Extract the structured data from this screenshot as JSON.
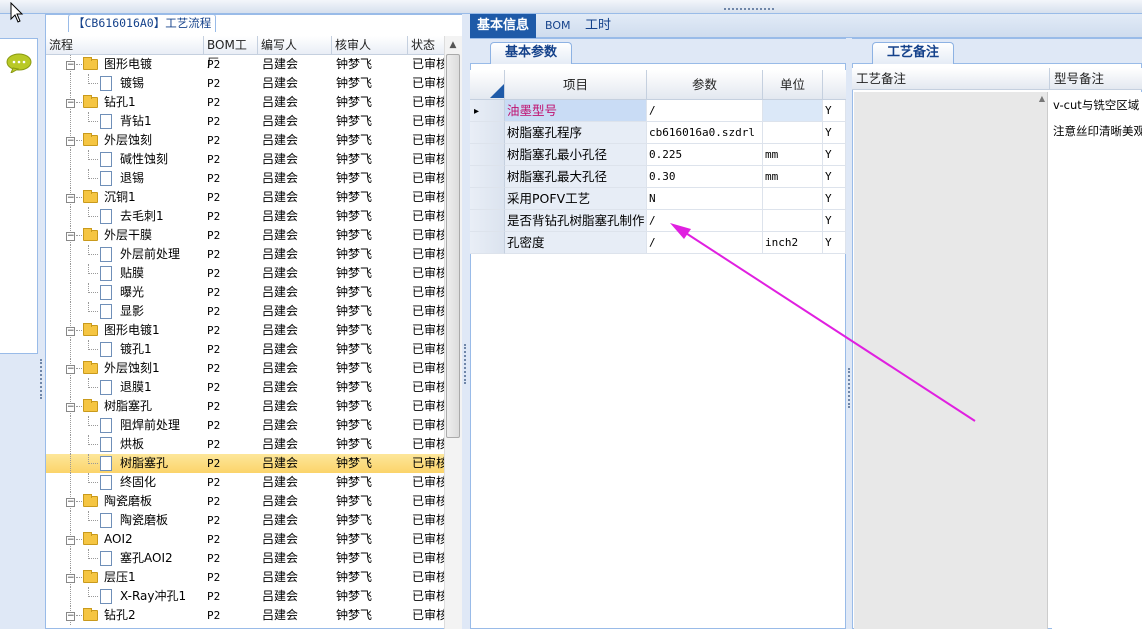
{
  "tree": {
    "title": "【CB616016A0】工艺流程",
    "columns": [
      "流程",
      "BOM工厂",
      "编写人",
      "核审人",
      "状态"
    ],
    "rows": [
      {
        "level": 1,
        "type": "folder",
        "name": "图形电镀",
        "bom": "P2",
        "author": "吕建会",
        "reviewer": "钟梦飞",
        "status": "已审核"
      },
      {
        "level": 2,
        "type": "doc",
        "name": "镀锡",
        "bom": "P2",
        "author": "吕建会",
        "reviewer": "钟梦飞",
        "status": "已审核"
      },
      {
        "level": 1,
        "type": "folder",
        "name": "钻孔1",
        "bom": "P2",
        "author": "吕建会",
        "reviewer": "钟梦飞",
        "status": "已审核"
      },
      {
        "level": 2,
        "type": "doc",
        "name": "背钻1",
        "bom": "P2",
        "author": "吕建会",
        "reviewer": "钟梦飞",
        "status": "已审核"
      },
      {
        "level": 1,
        "type": "folder",
        "name": "外层蚀刻",
        "bom": "P2",
        "author": "吕建会",
        "reviewer": "钟梦飞",
        "status": "已审核"
      },
      {
        "level": 2,
        "type": "doc",
        "name": "碱性蚀刻",
        "bom": "P2",
        "author": "吕建会",
        "reviewer": "钟梦飞",
        "status": "已审核"
      },
      {
        "level": 2,
        "type": "doc",
        "name": "退锡",
        "bom": "P2",
        "author": "吕建会",
        "reviewer": "钟梦飞",
        "status": "已审核"
      },
      {
        "level": 1,
        "type": "folder",
        "name": "沉铜1",
        "bom": "P2",
        "author": "吕建会",
        "reviewer": "钟梦飞",
        "status": "已审核"
      },
      {
        "level": 2,
        "type": "doc",
        "name": "去毛刺1",
        "bom": "P2",
        "author": "吕建会",
        "reviewer": "钟梦飞",
        "status": "已审核"
      },
      {
        "level": 1,
        "type": "folder",
        "name": "外层干膜",
        "bom": "P2",
        "author": "吕建会",
        "reviewer": "钟梦飞",
        "status": "已审核"
      },
      {
        "level": 2,
        "type": "doc",
        "name": "外层前处理",
        "bom": "P2",
        "author": "吕建会",
        "reviewer": "钟梦飞",
        "status": "已审核"
      },
      {
        "level": 2,
        "type": "doc",
        "name": "贴膜",
        "bom": "P2",
        "author": "吕建会",
        "reviewer": "钟梦飞",
        "status": "已审核"
      },
      {
        "level": 2,
        "type": "doc",
        "name": "曝光",
        "bom": "P2",
        "author": "吕建会",
        "reviewer": "钟梦飞",
        "status": "已审核"
      },
      {
        "level": 2,
        "type": "doc",
        "name": "显影",
        "bom": "P2",
        "author": "吕建会",
        "reviewer": "钟梦飞",
        "status": "已审核"
      },
      {
        "level": 1,
        "type": "folder",
        "name": "图形电镀1",
        "bom": "P2",
        "author": "吕建会",
        "reviewer": "钟梦飞",
        "status": "已审核"
      },
      {
        "level": 2,
        "type": "doc",
        "name": "镀孔1",
        "bom": "P2",
        "author": "吕建会",
        "reviewer": "钟梦飞",
        "status": "已审核"
      },
      {
        "level": 1,
        "type": "folder",
        "name": "外层蚀刻1",
        "bom": "P2",
        "author": "吕建会",
        "reviewer": "钟梦飞",
        "status": "已审核"
      },
      {
        "level": 2,
        "type": "doc",
        "name": "退膜1",
        "bom": "P2",
        "author": "吕建会",
        "reviewer": "钟梦飞",
        "status": "已审核"
      },
      {
        "level": 1,
        "type": "folder",
        "name": "树脂塞孔",
        "bom": "P2",
        "author": "吕建会",
        "reviewer": "钟梦飞",
        "status": "已审核"
      },
      {
        "level": 2,
        "type": "doc",
        "name": "阻焊前处理",
        "bom": "P2",
        "author": "吕建会",
        "reviewer": "钟梦飞",
        "status": "已审核"
      },
      {
        "level": 2,
        "type": "doc",
        "name": "烘板",
        "bom": "P2",
        "author": "吕建会",
        "reviewer": "钟梦飞",
        "status": "已审核"
      },
      {
        "level": 2,
        "type": "doc",
        "name": "树脂塞孔",
        "bom": "P2",
        "author": "吕建会",
        "reviewer": "钟梦飞",
        "status": "已审核",
        "selected": true
      },
      {
        "level": 2,
        "type": "doc",
        "name": "终固化",
        "bom": "P2",
        "author": "吕建会",
        "reviewer": "钟梦飞",
        "status": "已审核"
      },
      {
        "level": 1,
        "type": "folder",
        "name": "陶瓷磨板",
        "bom": "P2",
        "author": "吕建会",
        "reviewer": "钟梦飞",
        "status": "已审核"
      },
      {
        "level": 2,
        "type": "doc",
        "name": "陶瓷磨板",
        "bom": "P2",
        "author": "吕建会",
        "reviewer": "钟梦飞",
        "status": "已审核"
      },
      {
        "level": 1,
        "type": "folder",
        "name": "AOI2",
        "bom": "P2",
        "author": "吕建会",
        "reviewer": "钟梦飞",
        "status": "已审核"
      },
      {
        "level": 2,
        "type": "doc",
        "name": "塞孔AOI2",
        "bom": "P2",
        "author": "吕建会",
        "reviewer": "钟梦飞",
        "status": "已审核"
      },
      {
        "level": 1,
        "type": "folder",
        "name": "层压1",
        "bom": "P2",
        "author": "吕建会",
        "reviewer": "钟梦飞",
        "status": "已审核"
      },
      {
        "level": 2,
        "type": "doc",
        "name": "X-Ray冲孔1",
        "bom": "P2",
        "author": "吕建会",
        "reviewer": "钟梦飞",
        "status": "已审核"
      },
      {
        "level": 1,
        "type": "folder",
        "name": "钻孔2",
        "bom": "P2",
        "author": "吕建会",
        "reviewer": "钟梦飞",
        "status": "已审核"
      }
    ]
  },
  "middle": {
    "tabs": [
      "基本信息",
      "BOM",
      "工时"
    ],
    "subtab": "基本参数",
    "columns": [
      "项目",
      "参数",
      "单位"
    ],
    "rows": [
      {
        "item": "油墨型号",
        "value": "/",
        "unit": "",
        "flag": "Y",
        "current": true
      },
      {
        "item": "树脂塞孔程序",
        "value": "cb616016a0.szdrl",
        "unit": "",
        "flag": "Y"
      },
      {
        "item": "树脂塞孔最小孔径",
        "value": "0.225",
        "unit": "mm",
        "flag": "Y"
      },
      {
        "item": "树脂塞孔最大孔径",
        "value": "0.30",
        "unit": "mm",
        "flag": "Y"
      },
      {
        "item": "采用POFV工艺",
        "value": "N",
        "unit": "",
        "flag": "Y"
      },
      {
        "item": "是否背钻孔树脂塞孔制作",
        "value": "/",
        "unit": "",
        "flag": "Y"
      },
      {
        "item": "孔密度",
        "value": "/",
        "unit": "inch2",
        "flag": "Y"
      }
    ]
  },
  "right": {
    "subtab": "工艺备注",
    "col1": "工艺备注",
    "col2": "型号备注",
    "notes": [
      "v-cut与铣空区域",
      "注意丝印清晰美观"
    ]
  },
  "colors": {
    "accent": "#1e5aa8",
    "annotation": "#e020e0",
    "highlight": "#c0106f"
  },
  "icons": [
    "cursor-icon",
    "chat-bubble-icon",
    "folder-icon",
    "document-icon",
    "expander-icon",
    "row-pointer-icon"
  ]
}
